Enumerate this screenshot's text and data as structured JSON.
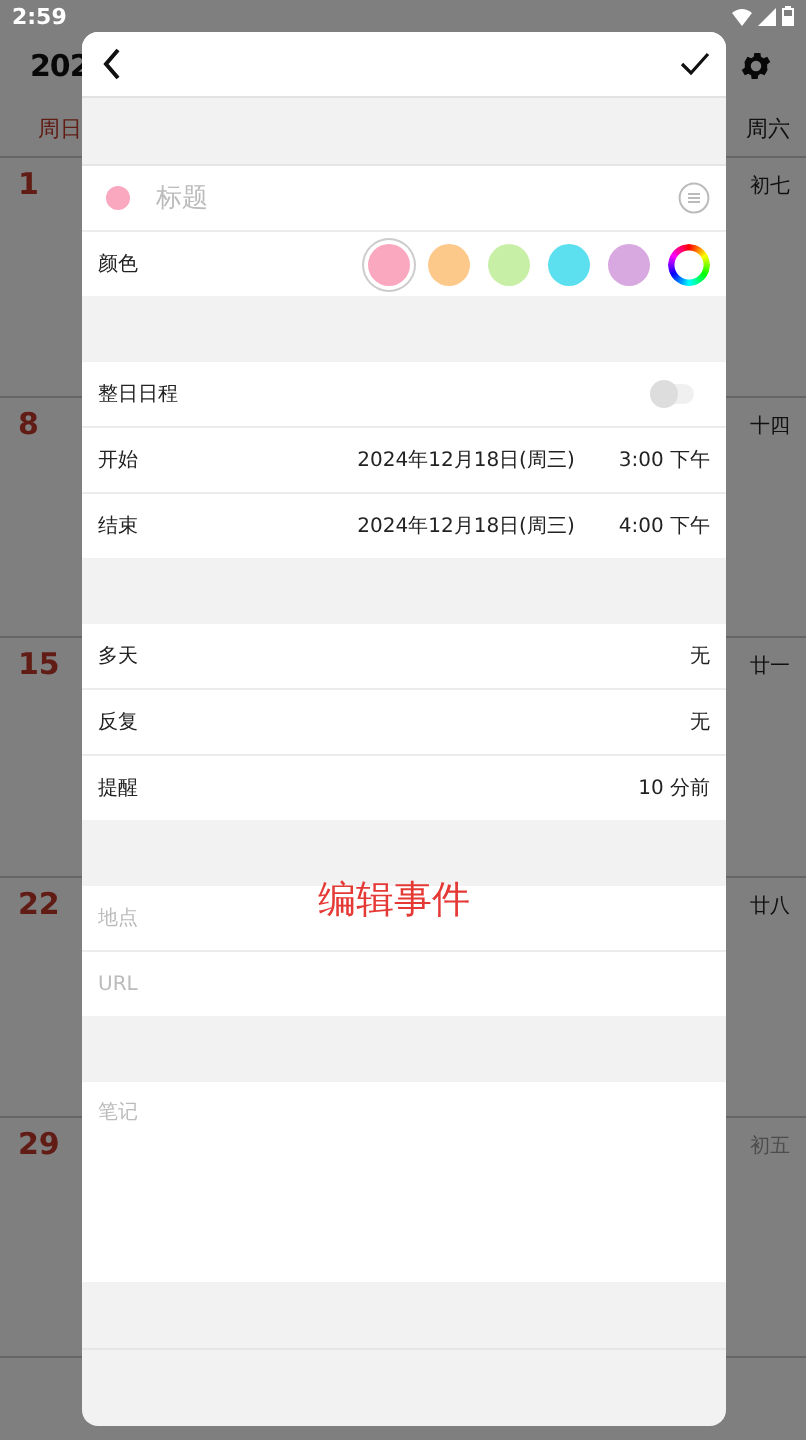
{
  "status_bar": {
    "time": "2:59"
  },
  "calendar": {
    "title": "202",
    "weekdays": [
      {
        "label": "周日",
        "kind": "sunday"
      },
      {
        "label": "周六",
        "kind": "weekday"
      }
    ],
    "weeks": [
      {
        "day": "1",
        "lunar": "初七",
        "muted": false
      },
      {
        "day": "8",
        "lunar": "十四",
        "muted": false
      },
      {
        "day": "15",
        "lunar": "廿一",
        "muted": false
      },
      {
        "day": "22",
        "lunar": "廿八",
        "muted": false
      },
      {
        "day": "29",
        "lunar": "初五",
        "muted": true
      }
    ]
  },
  "dialog": {
    "sections": [
      {
        "rows": [
          {
            "kind": "title",
            "placeholder": "标题"
          },
          {
            "kind": "colors",
            "label": "颜色",
            "options": [
              {
                "kind": "swatch",
                "color": "#f9a8bf",
                "selected": true
              },
              {
                "kind": "swatch",
                "color": "#fdc98a",
                "selected": false
              },
              {
                "kind": "swatch",
                "color": "#c8efa6",
                "selected": false
              },
              {
                "kind": "swatch",
                "color": "#5ce0f0",
                "selected": false
              },
              {
                "kind": "swatch",
                "color": "#d8a8e0",
                "selected": false
              },
              {
                "kind": "custom",
                "selected": false
              }
            ]
          }
        ]
      },
      {
        "rows": [
          {
            "kind": "toggle",
            "label": "整日日程",
            "on": false
          },
          {
            "kind": "datetime",
            "label": "开始",
            "date": "2024年12月18日(周三)",
            "time": "3:00 下午"
          },
          {
            "kind": "datetime",
            "label": "结束",
            "date": "2024年12月18日(周三)",
            "time": "4:00 下午"
          }
        ]
      },
      {
        "rows": [
          {
            "kind": "value",
            "label": "多天",
            "value": "无"
          },
          {
            "kind": "value",
            "label": "反复",
            "value": "无"
          },
          {
            "kind": "value",
            "label": "提醒",
            "value": "10 分前"
          }
        ]
      },
      {
        "rows": [
          {
            "kind": "input",
            "placeholder": "地点"
          },
          {
            "kind": "input",
            "placeholder": "URL"
          }
        ]
      },
      {
        "rows": [
          {
            "kind": "textarea",
            "placeholder": "笔记"
          }
        ]
      }
    ],
    "caption": "编辑事件"
  }
}
